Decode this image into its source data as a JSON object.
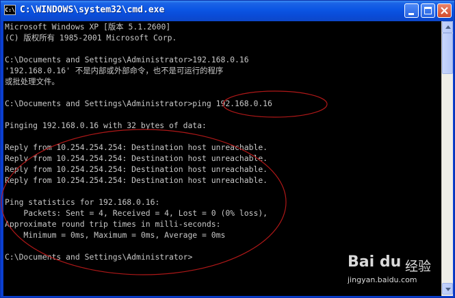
{
  "window": {
    "title": "C:\\WINDOWS\\system32\\cmd.exe",
    "icon_label": "C:\\"
  },
  "console": {
    "lines": [
      "Microsoft Windows XP [版本 5.1.2600]",
      "(C) 版权所有 1985-2001 Microsoft Corp.",
      "",
      "C:\\Documents and Settings\\Administrator>192.168.0.16",
      "'192.168.0.16' 不是内部或外部命令，也不是可运行的程序",
      "或批处理文件。",
      "",
      "C:\\Documents and Settings\\Administrator>ping 192.168.0.16",
      "",
      "Pinging 192.168.0.16 with 32 bytes of data:",
      "",
      "Reply from 10.254.254.254: Destination host unreachable.",
      "Reply from 10.254.254.254: Destination host unreachable.",
      "Reply from 10.254.254.254: Destination host unreachable.",
      "Reply from 10.254.254.254: Destination host unreachable.",
      "",
      "Ping statistics for 192.168.0.16:",
      "    Packets: Sent = 4, Received = 4, Lost = 0 (0% loss),",
      "Approximate round trip times in milli-seconds:",
      "    Minimum = 0ms, Maximum = 0ms, Average = 0ms",
      "",
      "C:\\Documents and Settings\\Administrator>"
    ]
  },
  "watermark": {
    "logo": "Bai du",
    "logo_sub": "经验",
    "url": "jingyan.baidu.com"
  },
  "colors": {
    "terminal_bg": "#000000",
    "terminal_text": "#c8c8c8",
    "titlebar": "#0b55e3",
    "annotation": "#b01818"
  },
  "icons": {
    "minimize": "minimize-icon",
    "maximize": "maximize-icon",
    "close": "close-icon",
    "scroll_up": "arrow-up-icon",
    "scroll_down": "arrow-down-icon"
  }
}
